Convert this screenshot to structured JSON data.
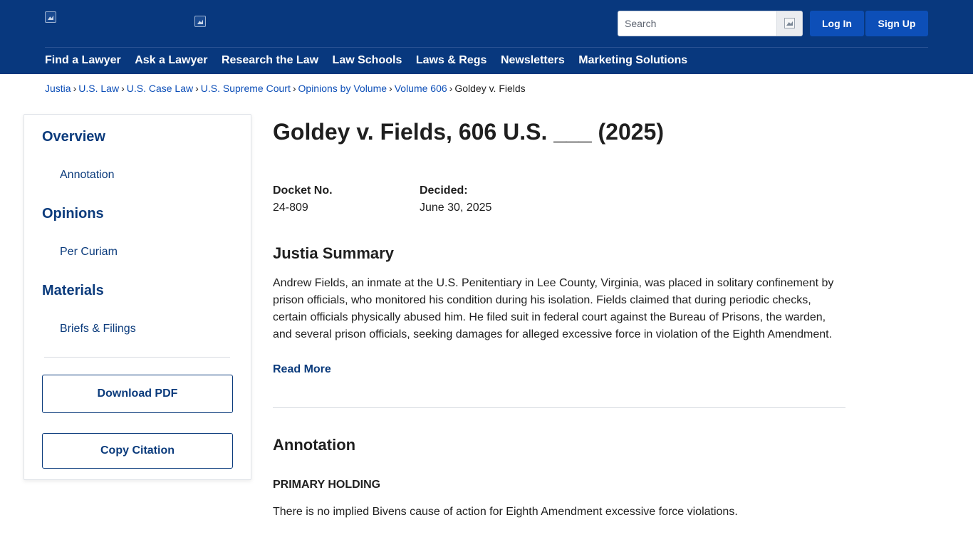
{
  "header": {
    "logo_alt": "",
    "search": {
      "placeholder": "Search",
      "value": ""
    },
    "login_label": "Log In",
    "signup_label": "Sign Up"
  },
  "nav": [
    {
      "label": "Find a Lawyer"
    },
    {
      "label": "Ask a Lawyer"
    },
    {
      "label": "Research the Law"
    },
    {
      "label": "Law Schools"
    },
    {
      "label": "Laws & Regs"
    },
    {
      "label": "Newsletters"
    },
    {
      "label": "Marketing Solutions"
    }
  ],
  "breadcrumb": {
    "items": [
      {
        "label": "Justia"
      },
      {
        "label": "U.S. Law"
      },
      {
        "label": "U.S. Case Law"
      },
      {
        "label": "U.S. Supreme Court"
      },
      {
        "label": "Opinions by Volume"
      },
      {
        "label": "Volume 606"
      }
    ],
    "separator": "›",
    "current": "Goldey v. Fields"
  },
  "sidebar": {
    "overview_heading": "Overview",
    "overview_link": "Annotation",
    "opinions_heading": "Opinions",
    "opinions_link": "Per Curiam",
    "materials_heading": "Materials",
    "materials_link": "Briefs & Filings",
    "download_label": "Download PDF",
    "cite_label": "Copy Citation"
  },
  "case": {
    "title": "Goldey v. Fields, 606 U.S. ___ (2025)",
    "docket_label": "Docket No.",
    "docket_value": "24-809",
    "decided_label": "Decided:",
    "decided_value": "June 30, 2025"
  },
  "summary": {
    "heading": "Justia Summary",
    "text": "Andrew Fields, an inmate at the U.S. Penitentiary in Lee County, Virginia, was placed in solitary confinement by prison officials, who monitored his condition during his isolation. Fields claimed that during periodic checks, certain officials physically abused him. He filed suit in federal court against the Bureau of Prisons, the warden, and several prison officials, seeking damages for alleged excessive force in violation of the Eighth Amendment.",
    "read_more": "Read More"
  },
  "annotation": {
    "heading": "Annotation",
    "holding_label": "PRIMARY HOLDING",
    "holding_text": "There is no implied Bivens cause of action for Eighth Amendment excessive force violations."
  },
  "colors": {
    "header_bg": "#08387e",
    "button_blue": "#0d4fb8",
    "link_dark": "#0b3b7c"
  },
  "icons": {
    "logo": "broken-image-icon",
    "search": "broken-image-icon"
  }
}
